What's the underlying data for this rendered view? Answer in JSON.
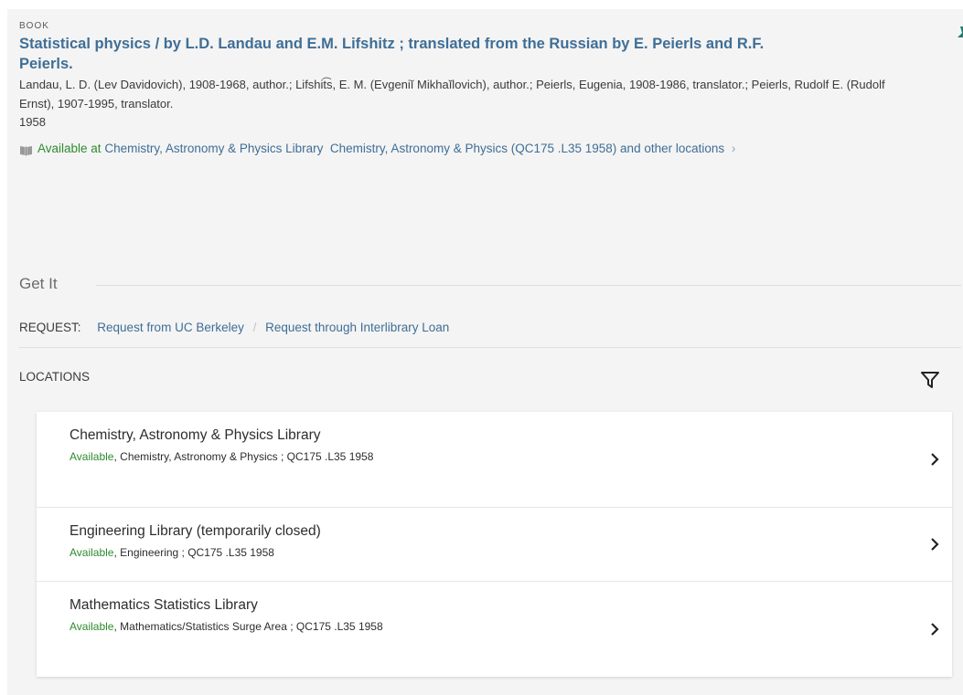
{
  "record": {
    "type": "BOOK",
    "title": "Statistical physics / by L.D. Landau and E.M. Lifshitz ; translated from the Russian by E. Peierls and R.F. Peierls.",
    "authors": "Landau, L. D. (Lev Davidovich), 1908-1968, author.; Lifshit͡s, E. M. (Evgeniĭ Mikhaĭlovich), author.; Peierls, Eugenia, 1908-1986, translator.; Peierls, Rudolf E. (Rudolf Ernst), 1907-1995, translator.",
    "year": "1958",
    "availability": {
      "status": "Available at",
      "library": "Chemistry, Astronomy & Physics Library",
      "detail": "Chemistry, Astronomy & Physics (QC175 .L35 1958) and other locations",
      "chevron": "›",
      "icon": "book-icon"
    }
  },
  "get_it": {
    "title": "Get It",
    "request_label": "REQUEST:",
    "request_links": [
      "Request from UC Berkeley",
      "Request through Interlibrary Loan"
    ],
    "separator": "/"
  },
  "locations": {
    "label": "LOCATIONS",
    "filter_icon": "filter-icon",
    "items": [
      {
        "name": "Chemistry, Astronomy & Physics Library",
        "status": "Available",
        "detail": ", Chemistry, Astronomy & Physics ; QC175 .L35 1958"
      },
      {
        "name": "Engineering Library (temporarily closed)",
        "status": "Available",
        "detail": ", Engineering ; QC175 .L35 1958"
      },
      {
        "name": "Mathematics Statistics Library",
        "status": "Available",
        "detail": ", Mathematics/Statistics Surge Area ; QC175 .L35 1958"
      }
    ]
  },
  "colors": {
    "link": "#3f6e96",
    "available": "#2e8b2e",
    "panel": "#f4f4f4",
    "pin": "#2a7a6a"
  }
}
